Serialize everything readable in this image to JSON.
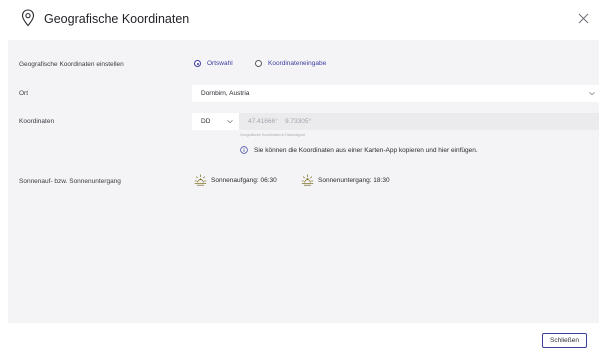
{
  "dialog": {
    "title": "Geografische Koordinaten",
    "icons": {
      "title_icon": "map-pin-icon",
      "close_icon": "close-icon"
    }
  },
  "rows": {
    "mode": {
      "label": "Geografische Koordinaten einstellen",
      "options": [
        {
          "label": "Ortswahl",
          "selected": true
        },
        {
          "label": "Koordinateneingabe",
          "selected": false
        }
      ]
    },
    "ort": {
      "label": "Ort",
      "value": "Dornbirn, Austria"
    },
    "koordinaten": {
      "label": "Koordinaten",
      "format_value": "DD",
      "latitude": "47.41666°",
      "longitude": "9.73305°",
      "helper": "Geografische Koordinaten in Dezimalgrad",
      "info": "Sie können die Koordinaten aus einer Karten-App kopieren und hier einfügen."
    },
    "sun": {
      "label": "Sonnenauf- bzw. Sonnenuntergang",
      "sunrise": "Sonnenaufgang: 06:30",
      "sunset": "Sonnenuntergang: 18:30"
    }
  },
  "footer": {
    "close_label": "Schließen"
  },
  "colors": {
    "accent": "#3d3f9e",
    "content_background": "#f4f4f6",
    "disabled_field": "#ebebee",
    "sun_icon": "#7a6a1e"
  }
}
